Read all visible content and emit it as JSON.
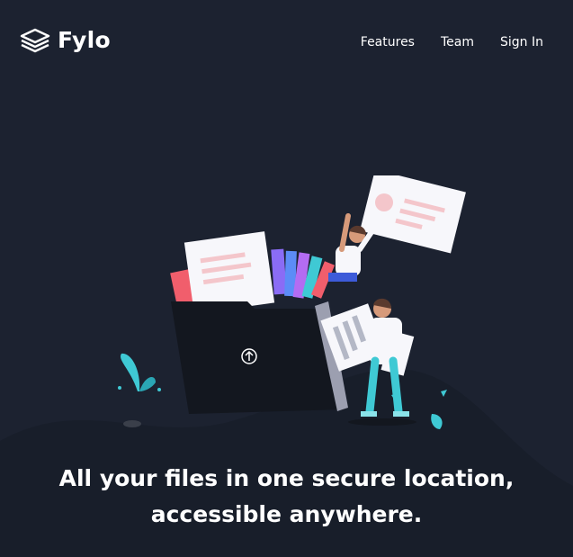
{
  "brand": {
    "name": "Fylo",
    "logo_icon": "stacked-layers-icon"
  },
  "nav": {
    "items": [
      {
        "label": "Features"
      },
      {
        "label": "Team"
      },
      {
        "label": "Sign In"
      }
    ]
  },
  "hero": {
    "headline_line1": "All your files in one secure location,",
    "headline_line2": "accessible anywhere.",
    "illustration_icon": "upload-arrow-icon"
  },
  "colors": {
    "background": "#1c2230",
    "curve": "#181e2a",
    "accent_cyan": "#3fc9d4",
    "accent_pink": "#f4979c",
    "text": "#ffffff"
  }
}
